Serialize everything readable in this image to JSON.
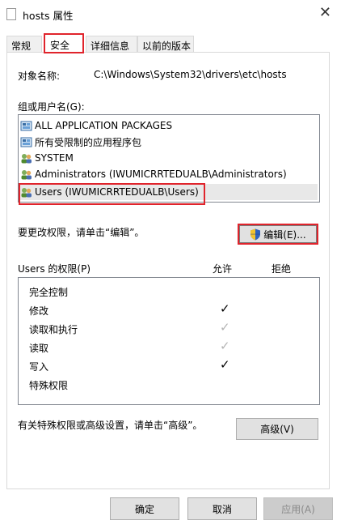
{
  "window": {
    "title": "hosts 属性",
    "close": "✕"
  },
  "tabs": [
    {
      "label": "常规",
      "active": false
    },
    {
      "label": "安全",
      "active": true
    },
    {
      "label": "详细信息",
      "active": false
    },
    {
      "label": "以前的版本",
      "active": false
    }
  ],
  "object": {
    "label": "对象名称:",
    "value": "C:\\Windows\\System32\\drivers\\etc\\hosts"
  },
  "groups": {
    "label": "组或用户名(G):",
    "items": [
      {
        "name": "ALL APPLICATION PACKAGES",
        "icon": "package-icon",
        "selected": false
      },
      {
        "name": "所有受限制的应用程序包",
        "icon": "package-icon",
        "selected": false
      },
      {
        "name": "SYSTEM",
        "icon": "users-icon",
        "selected": false
      },
      {
        "name": "Administrators (IWUMICRRTEDUALB\\Administrators)",
        "icon": "users-icon",
        "selected": false
      },
      {
        "name": "Users (IWUMICRRTEDUALB\\Users)",
        "icon": "users-icon",
        "selected": true
      }
    ]
  },
  "change_hint": "要更改权限，请单击“编辑”。",
  "edit_button": "编辑(E)...",
  "perms": {
    "label": "Users 的权限(P)",
    "allow_header": "允许",
    "deny_header": "拒绝",
    "rows": [
      {
        "name": "完全控制",
        "allow": "",
        "style": "none"
      },
      {
        "name": "修改",
        "allow": "✓",
        "style": "black"
      },
      {
        "name": "读取和执行",
        "allow": "✓",
        "style": "gray"
      },
      {
        "name": "读取",
        "allow": "✓",
        "style": "gray"
      },
      {
        "name": "写入",
        "allow": "✓",
        "style": "black"
      },
      {
        "name": "特殊权限",
        "allow": "",
        "style": "none"
      }
    ]
  },
  "advanced_hint": "有关特殊权限或高级设置，请单击“高级”。",
  "advanced_button": "高级(V)",
  "footer": {
    "ok": "确定",
    "cancel": "取消",
    "apply": "应用(A)"
  },
  "colors": {
    "highlight": "#e0242c",
    "selected_row": "#e8e8e8",
    "button_bg": "#e1e1e1"
  }
}
